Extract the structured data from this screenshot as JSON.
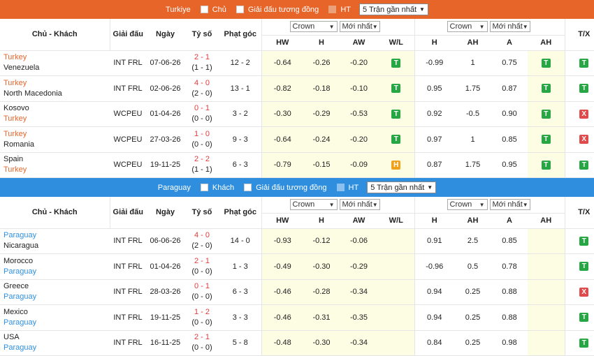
{
  "sections": [
    {
      "team": "Turkiye",
      "color": "#e8652a",
      "opt_side": "Chủ",
      "opt_same": "Giải đấu tương đồng",
      "opt_ht": "HT",
      "select": "5 Trận gần nhất",
      "headers": {
        "teams": "Chủ - Khách",
        "league": "Giải đấu",
        "date": "Ngày",
        "score": "Tỷ số",
        "corner": "Phạt góc",
        "tx": "T/X",
        "odds1": "Crown",
        "sort1": "Mới nhất",
        "odds2": "Crown",
        "sort2": "Mới nhất",
        "hw": "HW",
        "h": "H",
        "aw": "AW",
        "wl": "W/L",
        "h2": "H",
        "ah": "AH",
        "a": "A",
        "ah2": "AH"
      },
      "rows": [
        {
          "home": "Turkey",
          "away": "Venezuela",
          "hl": "home",
          "league": "INT FRL",
          "date": "07-06-26",
          "ft": "2 - 1",
          "ht": "(1 - 1)",
          "corner": "12 - 2",
          "hw": "-0.64",
          "h": "-0.26",
          "aw": "-0.20",
          "wl": "T",
          "oh": "-0.99",
          "ah": "1",
          "oa": "0.75",
          "ahr": "T",
          "tx": "T"
        },
        {
          "home": "Turkey",
          "away": "North Macedonia",
          "hl": "home",
          "league": "INT FRL",
          "date": "02-06-26",
          "ft": "4 - 0",
          "ht": "(2 - 0)",
          "corner": "13 - 1",
          "hw": "-0.82",
          "h": "-0.18",
          "aw": "-0.10",
          "wl": "T",
          "oh": "0.95",
          "ah": "1.75",
          "oa": "0.87",
          "ahr": "T",
          "tx": "T"
        },
        {
          "home": "Kosovo",
          "away": "Turkey",
          "hl": "away",
          "league": "WCPEU",
          "date": "01-04-26",
          "ft": "0 - 1",
          "ht": "(0 - 0)",
          "corner": "3 - 2",
          "hw": "-0.30",
          "h": "-0.29",
          "aw": "-0.53",
          "wl": "T",
          "oh": "0.92",
          "ah": "-0.5",
          "oa": "0.90",
          "ahr": "T",
          "tx": "X"
        },
        {
          "home": "Turkey",
          "away": "Romania",
          "hl": "home",
          "league": "WCPEU",
          "date": "27-03-26",
          "ft": "1 - 0",
          "ht": "(0 - 0)",
          "corner": "9 - 3",
          "hw": "-0.64",
          "h": "-0.24",
          "aw": "-0.20",
          "wl": "T",
          "oh": "0.97",
          "ah": "1",
          "oa": "0.85",
          "ahr": "T",
          "tx": "X"
        },
        {
          "home": "Spain",
          "away": "Turkey",
          "hl": "away",
          "league": "WCPEU",
          "date": "19-11-25",
          "ft": "2 - 2",
          "ht": "(1 - 1)",
          "corner": "6 - 3",
          "hw": "-0.79",
          "h": "-0.15",
          "aw": "-0.09",
          "wl": "H",
          "oh": "0.87",
          "ah": "1.75",
          "oa": "0.95",
          "ahr": "T",
          "tx": "T"
        }
      ]
    },
    {
      "team": "Paraguay",
      "color": "#2f8fde",
      "opt_side": "Khách",
      "opt_same": "Giải đấu tương đồng",
      "opt_ht": "HT",
      "select": "5 Trận gần nhất",
      "headers": {
        "teams": "Chủ - Khách",
        "league": "Giải đấu",
        "date": "Ngày",
        "score": "Tỷ số",
        "corner": "Phạt góc",
        "tx": "T/X",
        "odds1": "Crown",
        "sort1": "Mới nhất",
        "odds2": "Crown",
        "sort2": "Mới nhất",
        "hw": "HW",
        "h": "H",
        "aw": "AW",
        "wl": "W/L",
        "h2": "H",
        "ah": "AH",
        "a": "A",
        "ah2": "AH"
      },
      "rows": [
        {
          "home": "Paraguay",
          "away": "Nicaragua",
          "hl": "home",
          "league": "INT FRL",
          "date": "06-06-26",
          "ft": "4 - 0",
          "ht": "(2 - 0)",
          "corner": "14 - 0",
          "hw": "-0.93",
          "h": "-0.12",
          "aw": "-0.06",
          "wl": "",
          "oh": "0.91",
          "ah": "2.5",
          "oa": "0.85",
          "ahr": "",
          "tx": "T"
        },
        {
          "home": "Morocco",
          "away": "Paraguay",
          "hl": "away",
          "league": "INT FRL",
          "date": "01-04-26",
          "ft": "2 - 1",
          "ht": "(0 - 0)",
          "corner": "1 - 3",
          "hw": "-0.49",
          "h": "-0.30",
          "aw": "-0.29",
          "wl": "",
          "oh": "-0.96",
          "ah": "0.5",
          "oa": "0.78",
          "ahr": "",
          "tx": "T"
        },
        {
          "home": "Greece",
          "away": "Paraguay",
          "hl": "away",
          "league": "INT FRL",
          "date": "28-03-26",
          "ft": "0 - 1",
          "ht": "(0 - 0)",
          "corner": "6 - 3",
          "hw": "-0.46",
          "h": "-0.28",
          "aw": "-0.34",
          "wl": "",
          "oh": "0.94",
          "ah": "0.25",
          "oa": "0.88",
          "ahr": "",
          "tx": "X"
        },
        {
          "home": "Mexico",
          "away": "Paraguay",
          "hl": "away",
          "league": "INT FRL",
          "date": "19-11-25",
          "ft": "1 - 2",
          "ht": "(0 - 0)",
          "corner": "3 - 3",
          "hw": "-0.46",
          "h": "-0.31",
          "aw": "-0.35",
          "wl": "",
          "oh": "0.94",
          "ah": "0.25",
          "oa": "0.88",
          "ahr": "",
          "tx": "T"
        },
        {
          "home": "USA",
          "away": "Paraguay",
          "hl": "away",
          "league": "INT FRL",
          "date": "16-11-25",
          "ft": "2 - 1",
          "ht": "(0 - 0)",
          "corner": "5 - 8",
          "hw": "-0.48",
          "h": "-0.30",
          "aw": "-0.34",
          "wl": "",
          "oh": "0.84",
          "ah": "0.25",
          "oa": "0.98",
          "ahr": "",
          "tx": "T"
        }
      ]
    }
  ]
}
